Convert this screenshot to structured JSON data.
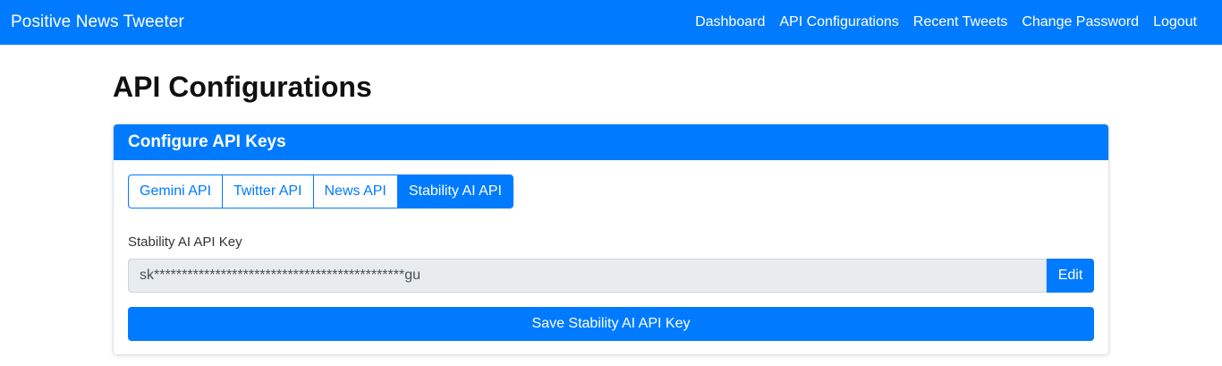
{
  "navbar": {
    "brand": "Positive News Tweeter",
    "links": [
      "Dashboard",
      "API Configurations",
      "Recent Tweets",
      "Change Password",
      "Logout"
    ]
  },
  "page": {
    "title": "API Configurations"
  },
  "card": {
    "header": "Configure API Keys",
    "tabs": [
      {
        "label": "Gemini API",
        "active": false
      },
      {
        "label": "Twitter API",
        "active": false
      },
      {
        "label": "News API",
        "active": false
      },
      {
        "label": "Stability AI API",
        "active": true
      }
    ],
    "field_label": "Stability AI API Key",
    "key_value": "sk*********************************************gu",
    "edit_label": "Edit",
    "save_label": "Save Stability AI API Key"
  },
  "colors": {
    "primary": "#007bff",
    "input_bg": "#e9ecef"
  }
}
